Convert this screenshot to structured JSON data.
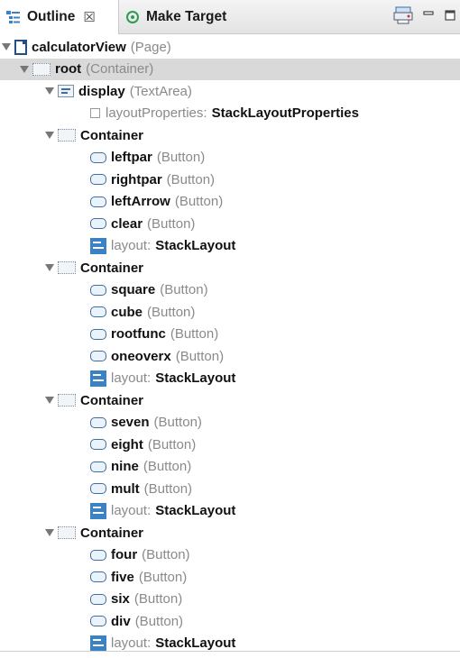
{
  "tabs": [
    {
      "label": "Outline",
      "close": "☒",
      "icon": "outline-icon"
    },
    {
      "label": "Make Target",
      "icon": "target-icon"
    }
  ],
  "toolbar": {
    "icons": [
      "sync-icon",
      "minimize-icon",
      "maximize-icon"
    ]
  },
  "tree": {
    "root": {
      "name": "calculatorView",
      "type": "(Page)"
    },
    "container_root": {
      "name": "root",
      "type": "(Container)"
    },
    "display": {
      "name": "display",
      "type": "(TextArea)"
    },
    "display_prop": {
      "label": "layoutProperties:",
      "value": "StackLayoutProperties"
    },
    "container_label": "Container",
    "layout_label": "layout:",
    "layout_value": "StackLayout",
    "button_type": "(Button)",
    "containers": [
      {
        "name": "Container",
        "buttons": [
          "leftpar",
          "rightpar",
          "leftArrow",
          "clear"
        ]
      },
      {
        "name": "Container",
        "buttons": [
          "square",
          "cube",
          "rootfunc",
          "oneoverx"
        ]
      },
      {
        "name": "Container",
        "buttons": [
          "seven",
          "eight",
          "nine",
          "mult"
        ]
      },
      {
        "name": "Container",
        "buttons": [
          "four",
          "five",
          "six",
          "div"
        ]
      }
    ]
  }
}
